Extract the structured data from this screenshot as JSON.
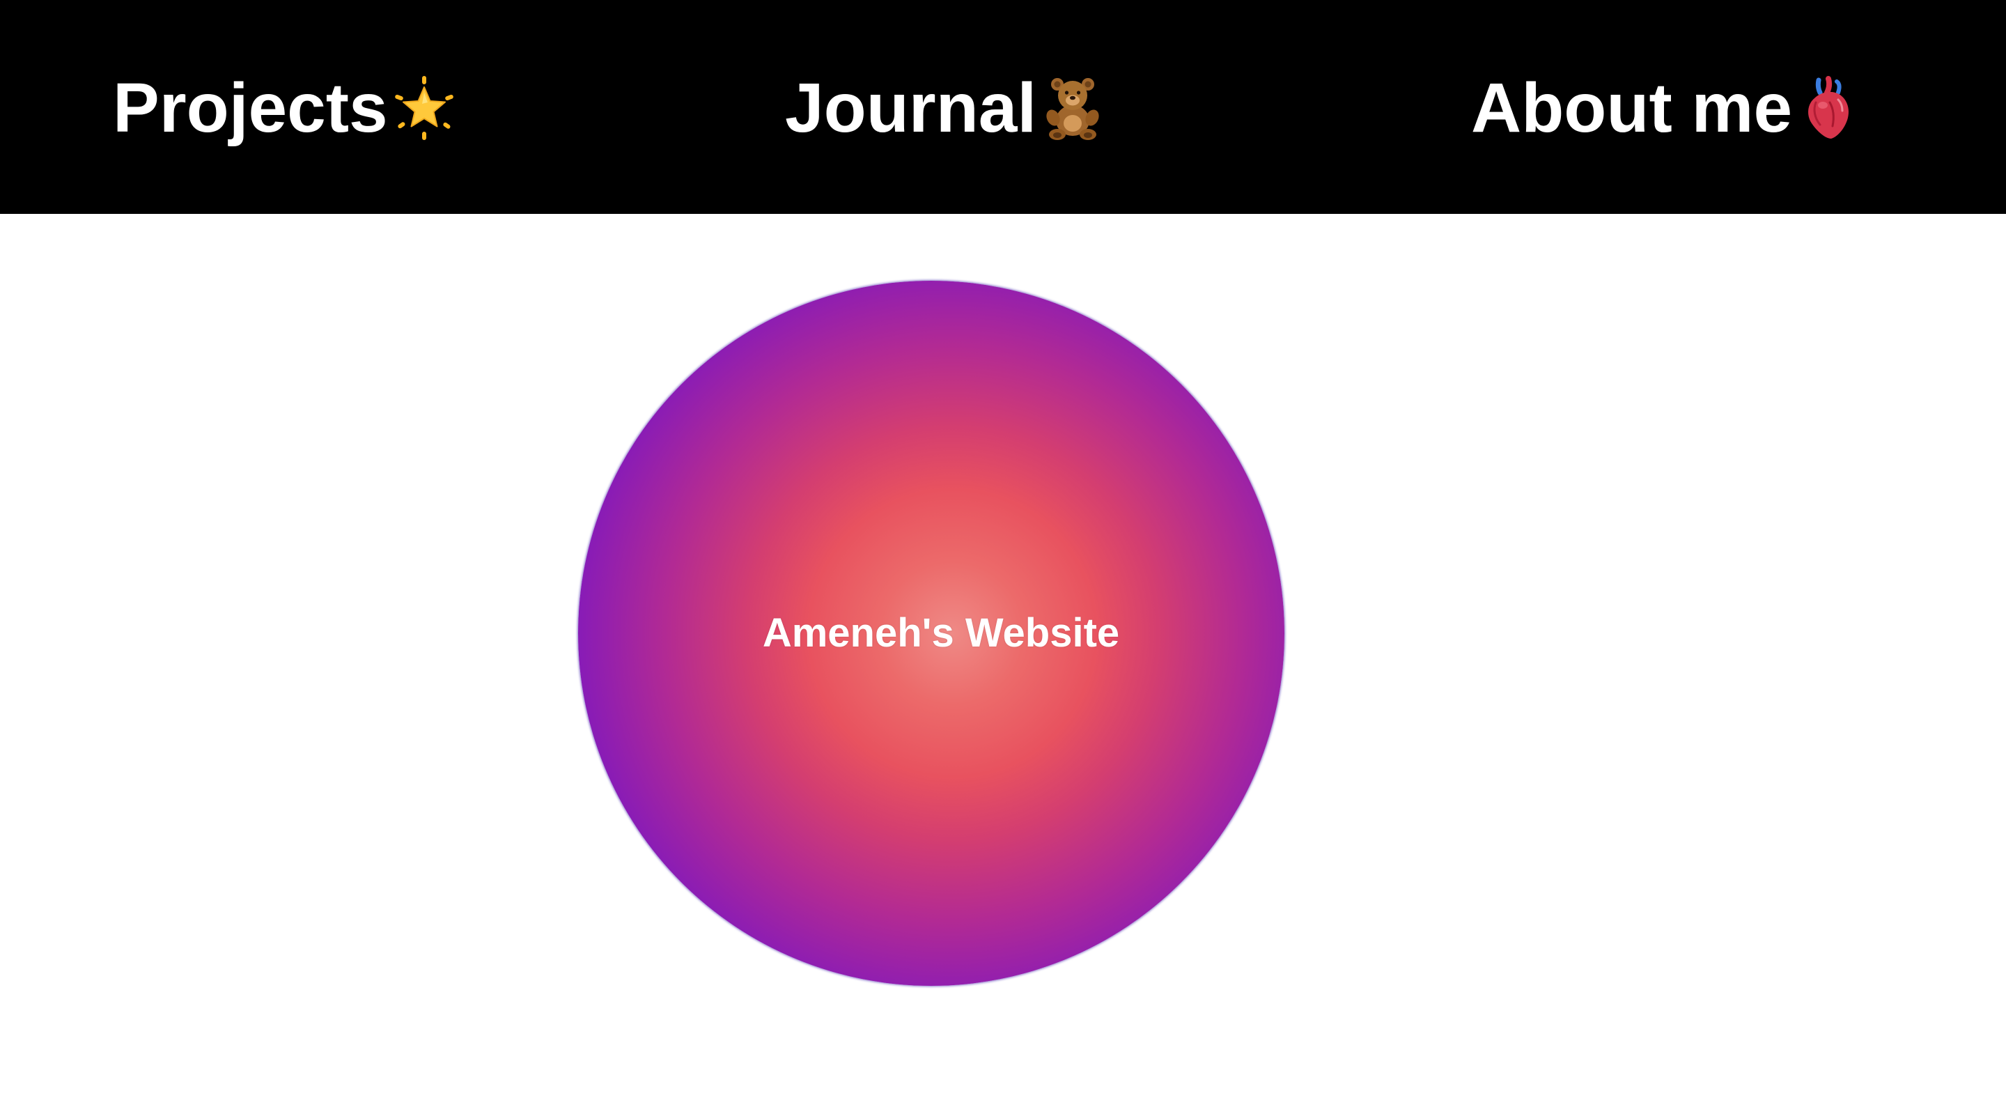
{
  "nav": {
    "items": [
      {
        "label": "Projects",
        "icon": "glowing-star-icon"
      },
      {
        "label": "Journal",
        "icon": "teddy-bear-icon"
      },
      {
        "label": "About me",
        "icon": "anatomical-heart-icon"
      }
    ]
  },
  "hero": {
    "title": "Ameneh's Website"
  },
  "colors": {
    "nav_background": "#000000",
    "nav_text": "#ffffff",
    "page_background": "#ffffff",
    "orb_center": "#ef8a86",
    "orb_mid": "#e8525f",
    "orb_edge": "#3a05c4"
  }
}
